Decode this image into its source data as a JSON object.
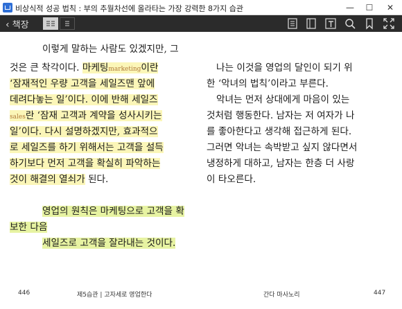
{
  "window": {
    "title": "비상식적 성공 법칙 : 부의 추월차선에 올라타는 가장 강력한 8가지 습관",
    "minimize": "—",
    "maximize": "☐",
    "close": "✕"
  },
  "toolbar": {
    "back_label": "책장",
    "back_arrow": "‹"
  },
  "left_page": {
    "lines": [
      "이렇게 말하는 사람도 있겠지만, 그",
      "것은 큰 착각이다.",
      "‘잠재적인 우량 고객을 세일즈맨 앞에",
      "데려다놓는 일’이다. 이에 반해 세일즈",
      "‘잠재 고객과 계약을 성사시키는",
      "일’이다. 다시 설명하겠지만, 효과적으",
      "로 세일즈를 하기 위해서는 고객을 설득",
      "하기보다 먼저 고객을 확실히 파악하는",
      "것이 해결의 열쇠가",
      "영업의 원칙은 마케팅으로 고객을 확",
      "보한 다음",
      "세일즈로 고객을 잘라내는 것이다."
    ],
    "hl_marketing": "마케팅",
    "marketing_en": "marketing",
    "iran": "이란",
    "sales_en": "sales",
    "ran": "란",
    "doenda": " 된다."
  },
  "right_page": {
    "lines": [
      "나는 이것을 영업의 달인이 되기 위",
      "한 ‘악녀의 법칙’이라고 부른다.",
      "악녀는 먼저 상대에게 마음이 있는",
      "것처럼 행동한다. 남자는 저 여자가 나",
      "를 좋아한다고 생각해 접근하게 된다.",
      "그러면 악녀는 속박받고 싶지 않다면서",
      "냉정하게 대하고, 남자는 한층 더 사랑",
      "이 타오른다."
    ]
  },
  "footer": {
    "left_page_number": "446",
    "chapter": "제5습관 | 고자세로 영업한다",
    "author": "간다 마사노리",
    "right_page_number": "447"
  }
}
